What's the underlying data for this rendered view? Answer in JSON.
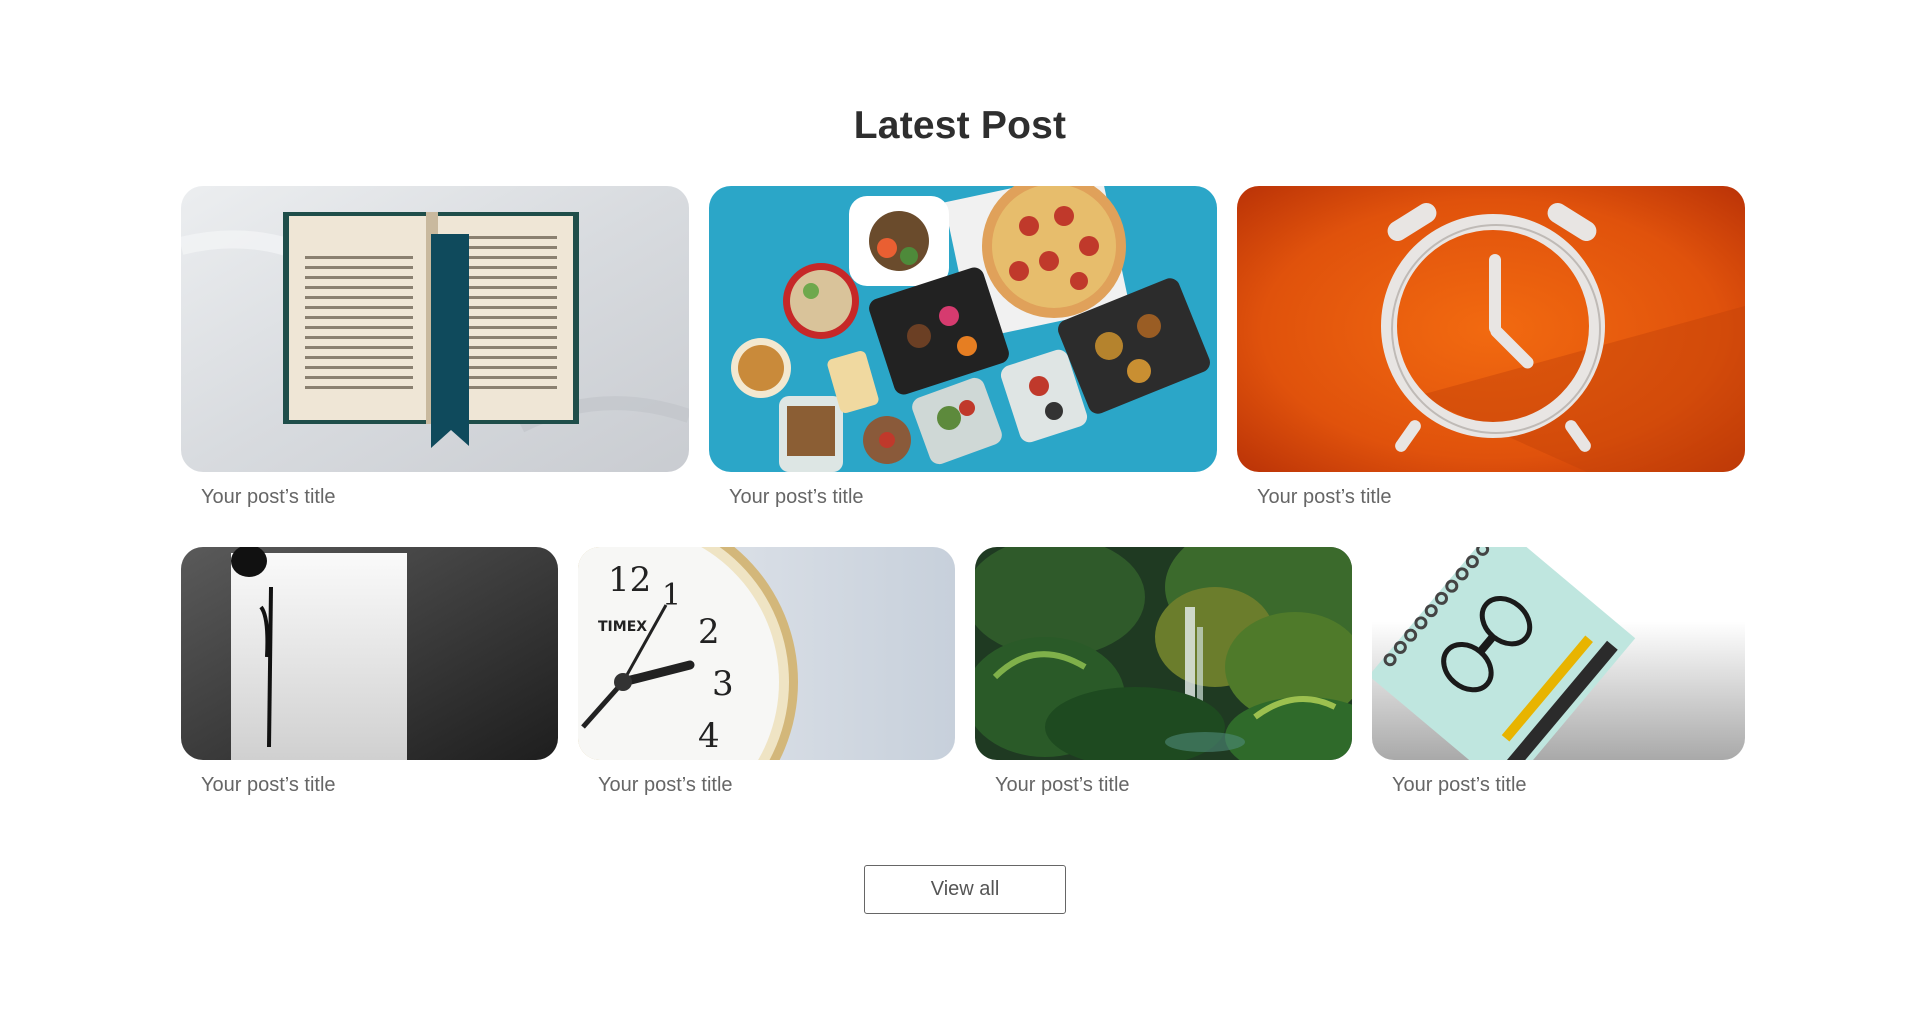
{
  "section": {
    "heading": "Latest Post",
    "view_all_label": "View all"
  },
  "posts": [
    {
      "title": "Your post’s title",
      "image": "open-book-on-bed"
    },
    {
      "title": "Your post’s title",
      "image": "food-containers-and-pizza"
    },
    {
      "title": "Your post’s title",
      "image": "orange-alarm-clock"
    },
    {
      "title": "Your post’s title",
      "image": "fountain-pen-and-paper"
    },
    {
      "title": "Your post’s title",
      "image": "timex-watch-face"
    },
    {
      "title": "Your post’s title",
      "image": "jungle-waterfall"
    },
    {
      "title": "Your post’s title",
      "image": "notebook-glasses-pencil"
    }
  ]
}
